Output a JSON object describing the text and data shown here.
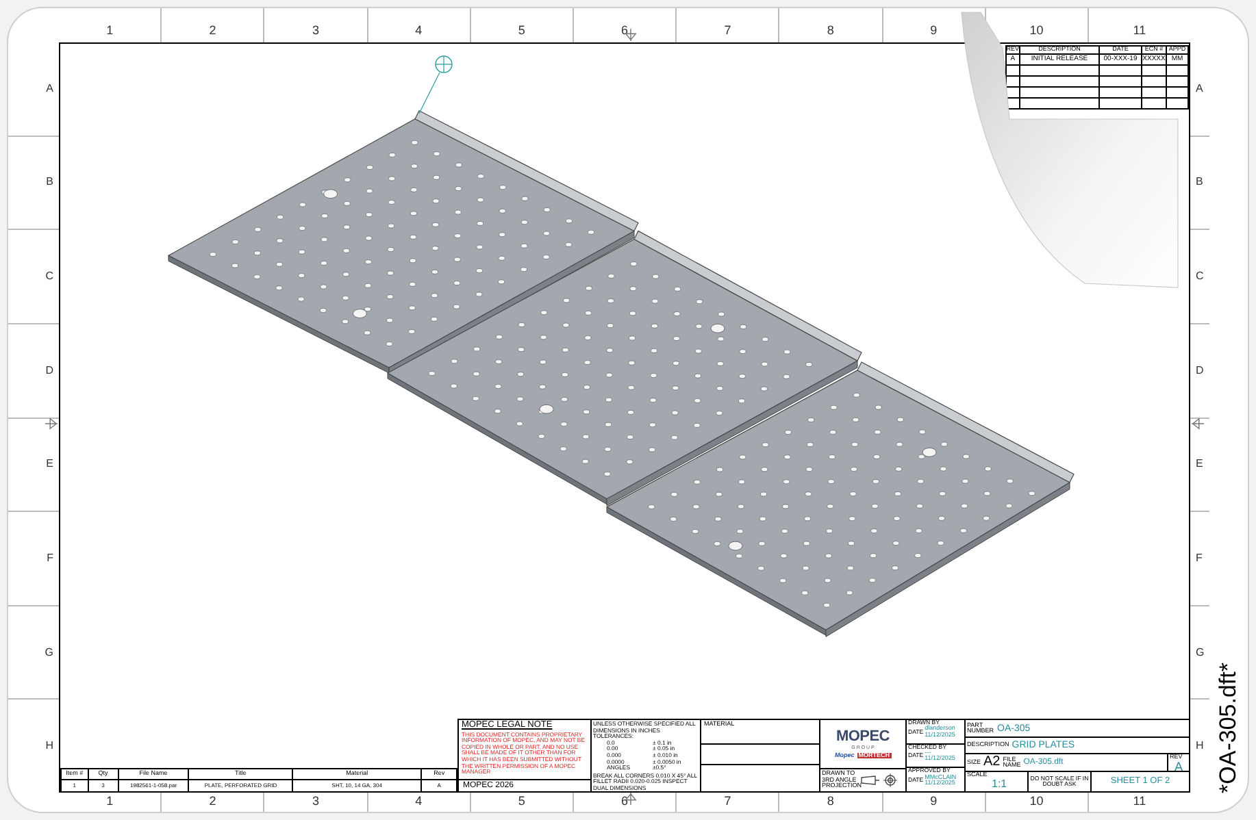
{
  "top_ruler": [
    "1",
    "2",
    "3",
    "4",
    "5",
    "6",
    "7",
    "8",
    "9",
    "10",
    "11"
  ],
  "bottom_ruler": [
    "1",
    "2",
    "3",
    "4",
    "5",
    "6",
    "7",
    "8",
    "9",
    "10",
    "11"
  ],
  "left_ruler": [
    "A",
    "B",
    "C",
    "D",
    "E",
    "F",
    "G",
    "H"
  ],
  "right_ruler": [
    "A",
    "B",
    "C",
    "D",
    "E",
    "F",
    "G",
    "H"
  ],
  "revision_table": {
    "columns": [
      "REV",
      "DESCRIPTION",
      "DATE",
      "ECN #",
      "APPD"
    ],
    "rows": [
      [
        "A",
        "INITIAL RELEASE",
        "00-XXX-19",
        "XXXXX",
        "MM"
      ]
    ]
  },
  "parts_list": {
    "columns": [
      "Item #",
      "Qty",
      "File Name",
      "Title",
      "Material",
      "Rev"
    ],
    "rows": [
      [
        "1",
        "3",
        "1982561-1-058.par",
        "PLATE, PERFORATED GRID",
        "SHT, 10, 14 GA, 304",
        "A"
      ]
    ]
  },
  "legal_note": {
    "title": "MOPEC LEGAL NOTE",
    "body": "THIS DOCUMENT CONTAINS PROPRIETARY INFORMATION OF MOPEC, AND MAY NOT BE COPIED IN WHOLE OR PART, AND NO USE SHALL BE MADE OF IT OTHER THAN FOR WHICH IT HAS BEEN SUBMITTED WITHOUT THE WRITTEN PERMISSION OF A MOPEC MANAGER",
    "footer": "MOPEC 2026"
  },
  "tolerances": {
    "heading": "UNLESS OTHERWISE SPECIFIED ALL DIMENSIONS IN INCHES TOLERANCES:",
    "rows": [
      [
        "0.0",
        "± 0.1 in"
      ],
      [
        "0.00",
        "± 0.05 in"
      ],
      [
        "0.000",
        "± 0.010 in"
      ],
      [
        "0.0000",
        "± 0.0050 in"
      ],
      [
        "ANGLES",
        "±0.5°"
      ]
    ],
    "note": "BREAK ALL CORNERS 0.010 X 45° ALL FILLET RADII 0.020-0.025 INSPECT DUAL DIMENSIONS"
  },
  "material": {
    "label": "MATERIAL"
  },
  "logo": {
    "name": "MOPEC",
    "group": "G R O U P",
    "brand_1": "Mopec",
    "brand_2": "MORTECH"
  },
  "projection": {
    "label": "DRAWN TO 3RD ANGLE PROJECTION"
  },
  "signatures": [
    {
      "label": "DRAWN BY",
      "date_label": "DATE",
      "name": "dlanderson",
      "date": "11/12/2025"
    },
    {
      "label": "CHECKED BY",
      "date_label": "DATE",
      "name": "---",
      "date": "11/12/2025"
    },
    {
      "label": "APPROVED BY",
      "date_label": "DATE",
      "name": "MMcCLAIN",
      "date": "11/12/2025"
    }
  ],
  "title_block": {
    "part_number_label": "PART NUMBER",
    "part_number": "OA-305",
    "description_label": "DESCRIPTION",
    "description": "GRID PLATES",
    "size_label": "SIZE",
    "size": "A2",
    "file_label": "FILE NAME",
    "file": "OA-305.dft",
    "rev_label": "REV",
    "rev": "A",
    "scale_label": "SCALE",
    "scale": "1:1",
    "scale_note": "DO NOT SCALE IF IN DOUBT ASK",
    "sheet": "SHEET 1 OF 2"
  },
  "file_tab": "*OA-305.dft*"
}
